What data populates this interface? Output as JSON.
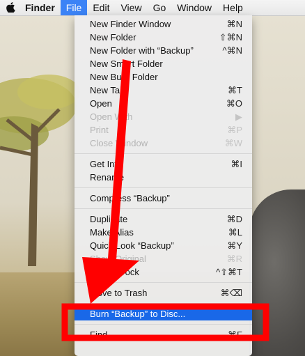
{
  "menubar": {
    "apple_icon": "apple-logo-icon",
    "items": [
      {
        "label": "Finder"
      },
      {
        "label": "File"
      },
      {
        "label": "Edit"
      },
      {
        "label": "View"
      },
      {
        "label": "Go"
      },
      {
        "label": "Window"
      },
      {
        "label": "Help"
      }
    ]
  },
  "file_menu": {
    "items": [
      {
        "label": "New Finder Window",
        "shortcut": "⌘N"
      },
      {
        "label": "New Folder",
        "shortcut": "⇧⌘N"
      },
      {
        "label": "New Folder with “Backup”",
        "shortcut": "^⌘N"
      },
      {
        "label": "New Smart Folder",
        "shortcut": ""
      },
      {
        "label": "New Burn Folder",
        "shortcut": ""
      },
      {
        "label": "New Tab",
        "shortcut": "⌘T"
      },
      {
        "label": "Open",
        "shortcut": "⌘O"
      },
      {
        "label": "Open With",
        "shortcut": "▶"
      },
      {
        "label": "Print",
        "shortcut": "⌘P"
      },
      {
        "label": "Close Window",
        "shortcut": "⌘W"
      },
      {
        "label": "Get Info",
        "shortcut": "⌘I"
      },
      {
        "label": "Rename",
        "shortcut": ""
      },
      {
        "label": "Compress “Backup”",
        "shortcut": ""
      },
      {
        "label": "Duplicate",
        "shortcut": "⌘D"
      },
      {
        "label": "Make Alias",
        "shortcut": "⌘L"
      },
      {
        "label": "Quick Look “Backup”",
        "shortcut": "⌘Y"
      },
      {
        "label": "Show Original",
        "shortcut": "⌘R"
      },
      {
        "label": "Add to Dock",
        "shortcut": "^⇧⌘T"
      },
      {
        "label": "Move to Trash",
        "shortcut": "⌘⌫"
      },
      {
        "label": "Burn “Backup” to Disc...",
        "shortcut": ""
      },
      {
        "label": "Find",
        "shortcut": "⌘F"
      }
    ]
  },
  "colors": {
    "highlight": "#1968e8",
    "menubar_active": "#3b83f6",
    "annotation": "#ff0000"
  }
}
